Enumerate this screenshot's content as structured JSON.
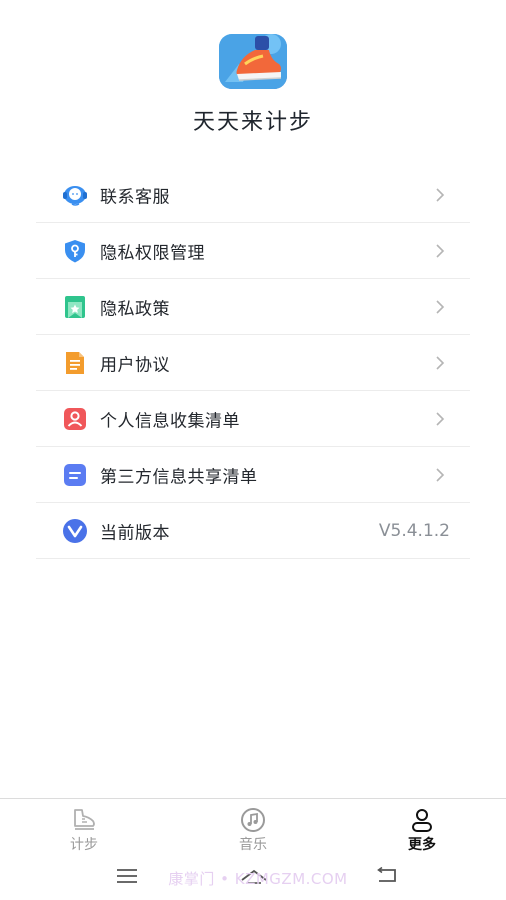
{
  "app": {
    "name": "天天来计步",
    "logo_icon": "sneaker-app-icon"
  },
  "menu": [
    {
      "id": "contact",
      "label": "联系客服",
      "icon": "headset-service-icon",
      "color": "#3a8ff0",
      "chevron": true
    },
    {
      "id": "privacy-permission",
      "label": "隐私权限管理",
      "icon": "shield-key-icon",
      "color": "#3a8ff0",
      "chevron": true
    },
    {
      "id": "privacy-policy",
      "label": "隐私政策",
      "icon": "bookmark-star-icon",
      "color": "#2fc48d",
      "chevron": true
    },
    {
      "id": "user-agreement",
      "label": "用户协议",
      "icon": "document-icon",
      "color": "#f39c2d",
      "chevron": true
    },
    {
      "id": "personal-info",
      "label": "个人信息收集清单",
      "icon": "person-card-icon",
      "color": "#f0575a",
      "chevron": true
    },
    {
      "id": "third-party",
      "label": "第三方信息共享清单",
      "icon": "list-card-icon",
      "color": "#5b7cf2",
      "chevron": true
    },
    {
      "id": "version",
      "label": "当前版本",
      "icon": "version-v-icon",
      "color": "#4a72e8",
      "chevron": false,
      "value": "V5.4.1.2"
    }
  ],
  "tabbar": {
    "tabs": [
      {
        "id": "steps",
        "label": "计步",
        "icon": "shoe-icon",
        "active": false
      },
      {
        "id": "music",
        "label": "音乐",
        "icon": "music-note-icon",
        "active": false
      },
      {
        "id": "more",
        "label": "更多",
        "icon": "person-icon",
        "active": true
      }
    ]
  },
  "system_nav": {
    "menu_icon": "menu-lines-icon",
    "home_icon": "home-chevron-icon",
    "back_icon": "back-arrow-icon"
  },
  "watermark": {
    "text": "康掌门 • KZMGZM.COM"
  },
  "colors": {
    "accent_blue": "#3a8ff0",
    "divider": "#ececec",
    "text_primary": "#23272d",
    "text_secondary": "#8a8f96"
  }
}
